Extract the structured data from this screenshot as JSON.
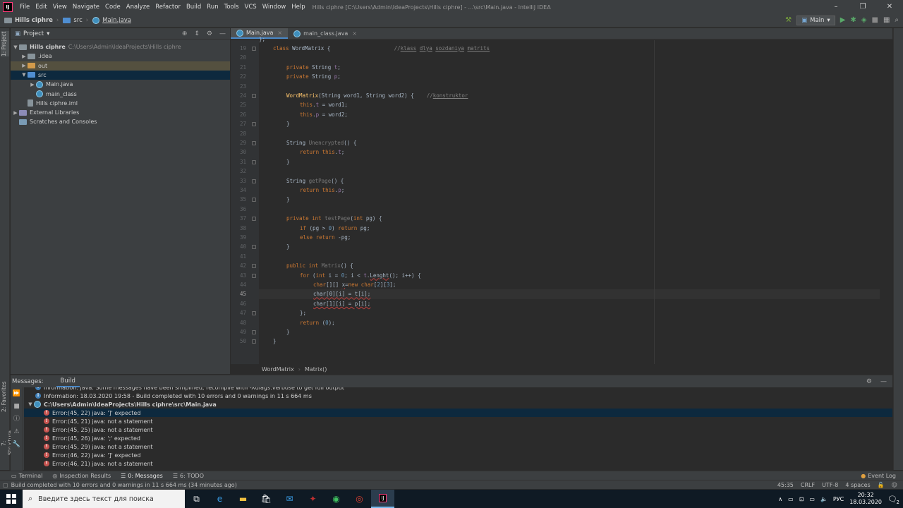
{
  "window": {
    "title": "Hills ciphre [C:\\Users\\Admin\\IdeaProjects\\Hills ciphre] - ...\\src\\Main.java - IntelliJ IDEA",
    "menu": [
      "File",
      "Edit",
      "View",
      "Navigate",
      "Code",
      "Analyze",
      "Refactor",
      "Build",
      "Run",
      "Tools",
      "VCS",
      "Window",
      "Help"
    ],
    "controls": [
      "–",
      "❐",
      "✕"
    ]
  },
  "navbar": {
    "crumbs": [
      "Hills ciphre",
      "src",
      "Main.java"
    ],
    "run_config": "Main"
  },
  "left_toolwindows": [
    "1: Project",
    "2: Favorites",
    "7: Structure"
  ],
  "project_panel": {
    "title": "Project",
    "tree": [
      {
        "label": "Hills ciphre",
        "hint": "C:\\Users\\Admin\\IdeaProjects\\Hills ciphre",
        "indent": 0,
        "arrow": "▼",
        "icon": "folder",
        "state": ""
      },
      {
        "label": ".idea",
        "hint": "",
        "indent": 1,
        "arrow": "▶",
        "icon": "folder",
        "state": ""
      },
      {
        "label": "out",
        "hint": "",
        "indent": 1,
        "arrow": "▶",
        "icon": "folder-orange",
        "state": "out"
      },
      {
        "label": "src",
        "hint": "",
        "indent": 1,
        "arrow": "▼",
        "icon": "folder-blue",
        "state": "sel"
      },
      {
        "label": "Main.java",
        "hint": "",
        "indent": 2,
        "arrow": "▶",
        "icon": "java",
        "state": ""
      },
      {
        "label": "main_class",
        "hint": "",
        "indent": 2,
        "arrow": "",
        "icon": "java",
        "state": ""
      },
      {
        "label": "Hills ciphre.iml",
        "hint": "",
        "indent": 1,
        "arrow": "",
        "icon": "iml",
        "state": ""
      },
      {
        "label": "External Libraries",
        "hint": "",
        "indent": 0,
        "arrow": "▶",
        "icon": "lib",
        "state": ""
      },
      {
        "label": "Scratches and Consoles",
        "hint": "",
        "indent": 0,
        "arrow": "",
        "icon": "scratch",
        "state": ""
      }
    ]
  },
  "editor": {
    "tabs": [
      {
        "label": "Main.java",
        "active": true
      },
      {
        "label": "main_class.java",
        "active": false
      }
    ],
    "current_line": 45,
    "lines": [
      {
        "n": 19,
        "html": "<span class=\"kw\">class</span> WordMatrix {                    <span class=\"cm\">//</span><span class=\"cmu\">klass</span> <span class=\"cmu\">dlya</span> <span class=\"cmu\">sozdaniya</span> <span class=\"cmu\">matrits</span>",
        "indent": 0
      },
      {
        "n": 20,
        "html": "",
        "indent": 0
      },
      {
        "n": 21,
        "html": "<span class=\"kw\">private</span> String <span class=\"fld\">t</span>;",
        "indent": 1
      },
      {
        "n": 22,
        "html": "<span class=\"kw\">private</span> String <span class=\"fld\">p</span>;",
        "indent": 1
      },
      {
        "n": 23,
        "html": "",
        "indent": 0
      },
      {
        "n": 24,
        "html": "<span class=\"fn\">WordMatrix</span>(String word1, String word2) {    <span class=\"cm\">//</span><span class=\"cmu\">konstruktor</span>",
        "indent": 1
      },
      {
        "n": 25,
        "html": "<span class=\"kw\">this</span>.<span class=\"fld\">t</span> = word1;",
        "indent": 2
      },
      {
        "n": 26,
        "html": "<span class=\"kw\">this</span>.<span class=\"fld\">p</span> = word2;",
        "indent": 2
      },
      {
        "n": 27,
        "html": "}",
        "indent": 1
      },
      {
        "n": 28,
        "html": "",
        "indent": 0
      },
      {
        "n": 29,
        "html": "String <span class=\"gy\">Unencrypted</span>() {",
        "indent": 1
      },
      {
        "n": 30,
        "html": "<span class=\"kw\">return this</span>.<span class=\"fld\">t</span>;",
        "indent": 2
      },
      {
        "n": 31,
        "html": "}",
        "indent": 1
      },
      {
        "n": 32,
        "html": "",
        "indent": 0
      },
      {
        "n": 33,
        "html": "String <span class=\"gy\">getPage</span>() {",
        "indent": 1
      },
      {
        "n": 34,
        "html": "<span class=\"kw\">return this</span>.<span class=\"fld\">p</span>;",
        "indent": 2
      },
      {
        "n": 35,
        "html": "}",
        "indent": 1
      },
      {
        "n": 36,
        "html": "",
        "indent": 0
      },
      {
        "n": 37,
        "html": "<span class=\"kw\">private int</span> <span class=\"gy\">testPage</span>(<span class=\"kw\">int</span> pg) {",
        "indent": 1
      },
      {
        "n": 38,
        "html": "<span class=\"kw\">if</span> (pg &gt; <span class=\"nm\">0</span>) <span class=\"kw\">return</span> pg;",
        "indent": 2
      },
      {
        "n": 39,
        "html": "<span class=\"kw\">else return</span> -pg;",
        "indent": 2
      },
      {
        "n": 40,
        "html": "}",
        "indent": 1
      },
      {
        "n": 41,
        "html": "",
        "indent": 0
      },
      {
        "n": 42,
        "html": "<span class=\"kw\">public int</span> <span class=\"gy\">Matrix</span>() {",
        "indent": 1
      },
      {
        "n": 43,
        "html": "<span class=\"kw\">for</span> (<span class=\"kw\">int</span> i = <span class=\"nm\">0</span>; i &lt; <span class=\"fld\">t</span>.<span class=\"errsq\">Lenght</span>(); i++) {",
        "indent": 2
      },
      {
        "n": 44,
        "html": "<span class=\"kw\">char</span>[][] <span class=\"errsq\">x</span>=<span class=\"kw\">new char</span>[<span class=\"nm\">2</span>][<span class=\"nm\">3</span>];",
        "indent": 3
      },
      {
        "n": 45,
        "html": "<span class=\"errsq\">char[0][i] = t[i];</span>",
        "indent": 3
      },
      {
        "n": 46,
        "html": "<span class=\"errsq\">char[1][i] = p[i];</span>",
        "indent": 3
      },
      {
        "n": 47,
        "html": "};",
        "indent": 2
      },
      {
        "n": 48,
        "html": "<span class=\"kw\">return</span> (<span class=\"nm\">0</span>);",
        "indent": 2
      },
      {
        "n": 49,
        "html": "}",
        "indent": 1
      },
      {
        "n": 50,
        "html": "}",
        "indent": 0
      }
    ],
    "breadcrumb": [
      "WordMatrix",
      "Matrix()"
    ]
  },
  "messages": {
    "title": "Messages:",
    "tab": "Build",
    "rows": [
      {
        "type": "info",
        "text": "Information: java: Some messages have been simplified; recompile with -Xdiags:verbose to get full output",
        "level": 1,
        "sel": false,
        "clip": true
      },
      {
        "type": "info",
        "text": "Information: 18.03.2020 19:58 - Build completed with 10 errors and 0 warnings in 11 s 664 ms",
        "level": 1,
        "sel": false
      },
      {
        "type": "file",
        "text": "C:\\Users\\Admin\\IdeaProjects\\Hills ciphre\\src\\Main.java",
        "level": 0,
        "sel": false
      },
      {
        "type": "error",
        "text": "Error:(45, 22)  java: ']' expected",
        "level": 2,
        "sel": true
      },
      {
        "type": "error",
        "text": "Error:(45, 21)  java: not a statement",
        "level": 2,
        "sel": false
      },
      {
        "type": "error",
        "text": "Error:(45, 25)  java: not a statement",
        "level": 2,
        "sel": false
      },
      {
        "type": "error",
        "text": "Error:(45, 26)  java: ';' expected",
        "level": 2,
        "sel": false
      },
      {
        "type": "error",
        "text": "Error:(45, 29)  java: not a statement",
        "level": 2,
        "sel": false
      },
      {
        "type": "error",
        "text": "Error:(46, 22)  java: ']' expected",
        "level": 2,
        "sel": false
      },
      {
        "type": "error",
        "text": "Error:(46, 21)  java: not a statement",
        "level": 2,
        "sel": false
      }
    ]
  },
  "bottom_tabs": [
    {
      "label": "Terminal",
      "icon": "▭",
      "active": false
    },
    {
      "label": "Inspection Results",
      "icon": "◎",
      "active": false
    },
    {
      "label": "0: Messages",
      "icon": "☰",
      "active": true
    },
    {
      "label": "6: TODO",
      "icon": "☰",
      "active": false
    }
  ],
  "event_log": "Event Log",
  "status": {
    "message": "Build completed with 10 errors and 0 warnings in 11 s 664 ms (34 minutes ago)",
    "position": "45:35",
    "line_sep": "CRLF",
    "encoding": "UTF-8",
    "indent": "4 spaces"
  },
  "taskbar": {
    "search_placeholder": "Введите здесь текст для поиска",
    "lang": "РУС",
    "time": "20:32",
    "date": "18.03.2020",
    "notifications": "2"
  }
}
